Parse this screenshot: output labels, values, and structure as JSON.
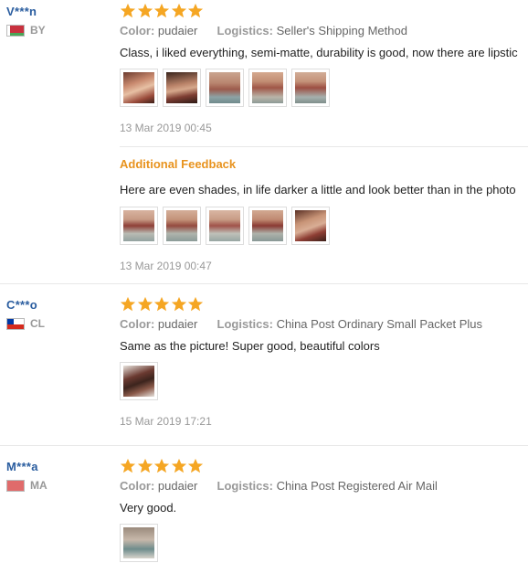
{
  "reviews": [
    {
      "user": "V***n",
      "country": "BY",
      "rating": 5,
      "color_label": "Color:",
      "color_value": "pudaier",
      "logistics_label": "Logistics:",
      "logistics_value": "Seller's Shipping Method",
      "text": "Class, i liked everything, semi-matte, durability is good, now there are lipstic",
      "photo_count": 5,
      "date": "13 Mar 2019 00:45",
      "feedback_title": "Additional Feedback",
      "feedback_text": "Here are even shades, in life darker a little and look better than in the photo",
      "feedback_photo_count": 5,
      "feedback_date": "13 Mar 2019 00:47"
    },
    {
      "user": "C***o",
      "country": "CL",
      "rating": 5,
      "color_label": "Color:",
      "color_value": "pudaier",
      "logistics_label": "Logistics:",
      "logistics_value": "China Post Ordinary Small Packet Plus",
      "text": "Same as the picture! Super good, beautiful colors",
      "photo_count": 1,
      "date": "15 Mar 2019 17:21"
    },
    {
      "user": "M***a",
      "country": "MA",
      "rating": 5,
      "color_label": "Color:",
      "color_value": "pudaier",
      "logistics_label": "Logistics:",
      "logistics_value": "China Post Registered Air Mail",
      "text": "Very good.",
      "photo_count": 1
    }
  ],
  "colors": {
    "star": "#f5a623",
    "username": "#2a5d9f",
    "feedback_title": "#e8931e"
  },
  "icons": {
    "star": "star-icon",
    "flag_by": "belarus-flag-icon",
    "flag_cl": "chile-flag-icon",
    "flag_ma": "morocco-flag-icon"
  }
}
